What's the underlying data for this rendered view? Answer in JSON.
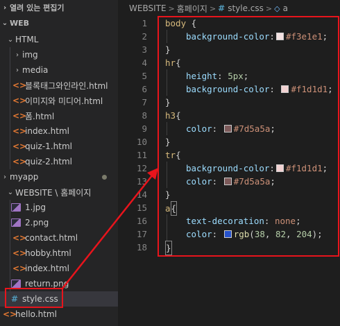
{
  "explorer": {
    "open_editors_label": "열려 있는 편집기",
    "workspace_label": "WEB",
    "items": [
      {
        "label": "HTML",
        "type": "folder-open"
      },
      {
        "label": "img",
        "type": "folder"
      },
      {
        "label": "media",
        "type": "folder"
      },
      {
        "label": "블록태그와인라인.html",
        "type": "html"
      },
      {
        "label": "이미지와 미디어.html",
        "type": "html"
      },
      {
        "label": "폼.html",
        "type": "html"
      },
      {
        "label": "index.html",
        "type": "html"
      },
      {
        "label": "quiz-1.html",
        "type": "html"
      },
      {
        "label": "quiz-2.html",
        "type": "html"
      },
      {
        "label": "myapp",
        "type": "folder"
      },
      {
        "label": "WEBSITE \\ 홈페이지",
        "type": "folder-open"
      },
      {
        "label": "1.jpg",
        "type": "img"
      },
      {
        "label": "2.png",
        "type": "img"
      },
      {
        "label": "contact.html",
        "type": "html"
      },
      {
        "label": "hobby.html",
        "type": "html"
      },
      {
        "label": "index.html",
        "type": "html"
      },
      {
        "label": "return.png",
        "type": "img"
      },
      {
        "label": "style.css",
        "type": "css"
      },
      {
        "label": "hello.html",
        "type": "html"
      }
    ],
    "css_icon": "#",
    "html_icon": "<>"
  },
  "breadcrumb": {
    "parts": [
      "WEBSITE",
      "홈페이지",
      "style.css",
      "a"
    ],
    "separator": ">"
  },
  "editor": {
    "line_numbers": [
      "1",
      "2",
      "3",
      "4",
      "5",
      "6",
      "7",
      "8",
      "9",
      "10",
      "11",
      "12",
      "13",
      "14",
      "15",
      "16",
      "17",
      "18"
    ],
    "lines": {
      "l1_sel": "body",
      "l1_brace": " {",
      "l2_prop": "background-color",
      "l2_val": "#f3e1e1",
      "l2_color": "#f3e1e1",
      "l3": "}",
      "l4_sel": "hr",
      "l4_brace": "{",
      "l5_prop": "height",
      "l5_num": "5px",
      "l6_prop": "background-color",
      "l6_val": "#f1d1d1",
      "l6_color": "#f1d1d1",
      "l7": "}",
      "l8_sel": "h3",
      "l8_brace": "{",
      "l9_prop": "color",
      "l9_val": "#7d5a5a",
      "l9_color": "#7d5a5a",
      "l10": "}",
      "l11_sel": "tr",
      "l11_brace": "{",
      "l12_prop": "background-color",
      "l12_val": "#f1d1d1",
      "l12_color": "#f1d1d1",
      "l13_prop": "color",
      "l13_val": "#7d5a5a",
      "l13_color": "#7d5a5a",
      "l14": "}",
      "l15_sel": "a",
      "l15_brace": "{",
      "l16_prop": "text-decoration",
      "l16_val": "none",
      "l17_prop": "color",
      "l17_fn": "rgb",
      "l17_open": "(",
      "l17_n1": "38",
      "l17_n2": "82",
      "l17_n3": "204",
      "l17_close": ");",
      "l17_color": "#2652cc",
      "l18": "}"
    }
  },
  "annotation_color": "#e8141c"
}
